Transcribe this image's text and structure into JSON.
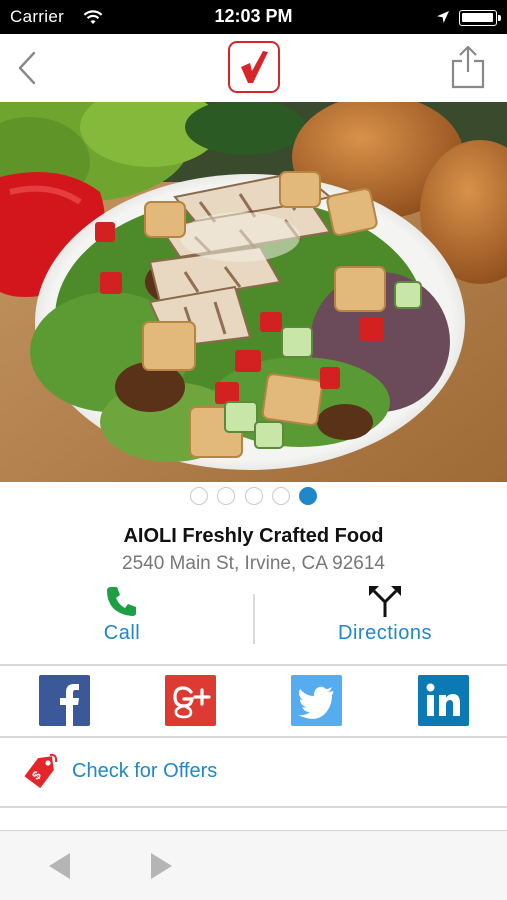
{
  "status_bar": {
    "carrier": "Carrier",
    "time": "12:03 PM",
    "icons": [
      "wifi-icon",
      "location-arrow-icon",
      "battery-icon"
    ]
  },
  "nav": {
    "back_icon": "chevron-left-icon",
    "logo_icon": "red-checkmark-logo",
    "share_icon": "share-icon"
  },
  "gallery": {
    "page_count": 5,
    "current_page": 5,
    "photo": "salad-bowl-photo"
  },
  "business": {
    "name": "AIOLI Freshly Crafted Food",
    "address": "2540 Main St, Irvine, CA 92614"
  },
  "actions": {
    "call_label": "Call",
    "directions_label": "Directions",
    "call_color": "#1e9e45",
    "link_color": "#1e88c9"
  },
  "social": [
    {
      "name": "Facebook",
      "glyph": "f",
      "color": "#3b5998"
    },
    {
      "name": "Google+",
      "glyph": "g+",
      "color": "#dc3a33"
    },
    {
      "name": "Twitter",
      "glyph": "bird",
      "color": "#55acee"
    },
    {
      "name": "LinkedIn",
      "glyph": "in",
      "color": "#0b79b4"
    }
  ],
  "offers": {
    "label": "Check for Offers",
    "icon": "price-tag-icon",
    "tag_color": "#e4262b"
  },
  "toolbar": {
    "back_icon": "triangle-left-icon",
    "forward_icon": "triangle-right-icon"
  }
}
